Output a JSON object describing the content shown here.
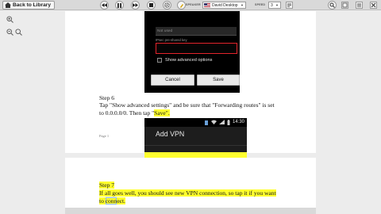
{
  "toolbar": {
    "back_label": "Back to Library",
    "speaker_label": "SPEAKER",
    "speaker_value": "David Desktop",
    "speed_label": "SPEED",
    "speed_value": "3"
  },
  "phone1": {
    "field1_value": "Not used",
    "field2_label": "IPsec pre-shared key",
    "advanced_label": "Show advanced options",
    "cancel_label": "Cancel",
    "save_label": "Save"
  },
  "doc": {
    "step6_title": "Step 6",
    "step6_line1": "Tap \"Show advanced settings\" and be sure that \"Forwarding routes\" is set",
    "step6_line2_pre": "to 0.0.0.0/0. Then tap \"",
    "step6_line2_hl": "Save",
    "step6_line2_post": "\".",
    "page_number": "Page 1",
    "step7_title": "Step 7",
    "step7_line1": "If all goes well, you should see new VPN connection, so tap it if you want",
    "step7_line2_pre": "to ",
    "step7_line2_sel": "conn",
    "step7_line2_post": "ect."
  },
  "phone2": {
    "time": "14:30",
    "title": "Add VPN"
  },
  "colors": {
    "highlight": "#ffff2e",
    "field_error": "#e3242b"
  }
}
